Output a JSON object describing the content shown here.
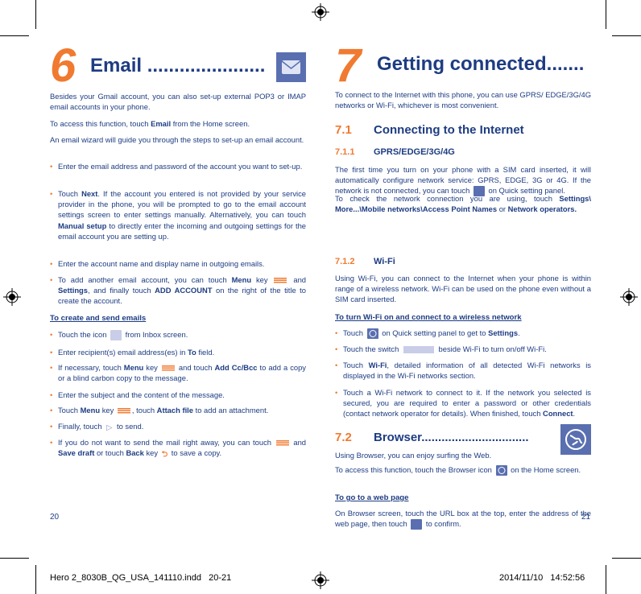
{
  "left": {
    "chapter_number": "6",
    "chapter_title": "Email ......................",
    "chapter_icon": "email-envelope-icon",
    "blocks": [
      {
        "type": "p",
        "seg": [
          {
            "t": "Besides your Gmail account, you can also set-up external POP3 or IMAP email accounts in your phone."
          }
        ]
      },
      {
        "type": "p",
        "seg": [
          {
            "t": "To access this function, touch "
          },
          {
            "t": "Email",
            "b": true
          },
          {
            "t": " from the Home screen."
          }
        ]
      },
      {
        "type": "p",
        "seg": [
          {
            "t": "An email wizard will guide you through the steps to set-up an email account."
          }
        ]
      },
      {
        "type": "bullet",
        "seg": [
          {
            "t": "Enter the email address and password of the account you want to set-up."
          }
        ]
      },
      {
        "type": "bullet",
        "seg": [
          {
            "t": "Touch "
          },
          {
            "t": "Next",
            "b": true
          },
          {
            "t": ". If the account you entered is not provided by your service provider in the phone, you will be prompted to go to the email account settings screen to enter settings manually. Alternatively, you can touch "
          },
          {
            "t": "Manual setup",
            "b": true
          },
          {
            "t": " to directly enter the incoming and outgoing settings for the email account you are setting up."
          }
        ]
      },
      {
        "type": "bullet",
        "seg": [
          {
            "t": "Enter the account name and display name in outgoing emails."
          }
        ]
      },
      {
        "type": "bullet",
        "seg": [
          {
            "t": "To add another email account, you can touch "
          },
          {
            "t": "Menu",
            "b": true
          },
          {
            "t": " key "
          },
          {
            "icon": "menu-key-icon"
          },
          {
            "t": " and "
          },
          {
            "t": "Settings",
            "b": true
          },
          {
            "t": ", and finally touch "
          },
          {
            "t": "ADD ACCOUNT",
            "b": true
          },
          {
            "t": " on the right of the title to create the account."
          }
        ]
      },
      {
        "type": "hlink",
        "seg": [
          {
            "t": "To create and send emails"
          }
        ]
      },
      {
        "type": "bullet",
        "seg": [
          {
            "t": "Touch the icon "
          },
          {
            "icon": "compose-email-icon"
          },
          {
            "t": " from Inbox screen."
          }
        ]
      },
      {
        "type": "bullet",
        "seg": [
          {
            "t": "Enter recipient(s) email address(es) in "
          },
          {
            "t": "To",
            "b": true
          },
          {
            "t": " field."
          }
        ]
      },
      {
        "type": "bullet",
        "seg": [
          {
            "t": "If necessary, touch "
          },
          {
            "t": "Menu",
            "b": true
          },
          {
            "t": " key "
          },
          {
            "icon": "menu-key-icon"
          },
          {
            "t": " and touch "
          },
          {
            "t": "Add Cc/Bcc",
            "b": true
          },
          {
            "t": " to add a copy or a blind carbon copy to the message."
          }
        ]
      },
      {
        "type": "bullet",
        "seg": [
          {
            "t": "Enter the subject and the content of the message."
          }
        ]
      },
      {
        "type": "bullet",
        "seg": [
          {
            "t": "Touch "
          },
          {
            "t": "Menu",
            "b": true
          },
          {
            "t": " key "
          },
          {
            "icon": "menu-key-icon"
          },
          {
            "t": ", touch "
          },
          {
            "t": "Attach file",
            "b": true
          },
          {
            "t": " to add an attachment."
          }
        ]
      },
      {
        "type": "bullet",
        "seg": [
          {
            "t": "Finally, touch "
          },
          {
            "icon": "send-icon"
          },
          {
            "t": " to send."
          }
        ]
      },
      {
        "type": "bullet",
        "seg": [
          {
            "t": "If you do not want to send the mail right away, you can touch "
          },
          {
            "icon": "menu-key-icon"
          },
          {
            "t": " and "
          },
          {
            "t": "Save draft",
            "b": true
          },
          {
            "t": " or touch "
          },
          {
            "t": "Back",
            "b": true
          },
          {
            "t": " key "
          },
          {
            "icon": "back-key-icon"
          },
          {
            "t": " to save a copy."
          }
        ]
      }
    ],
    "page_number": "20"
  },
  "right": {
    "chapter_number": "7",
    "chapter_title": "Getting connected.......",
    "blocks": [
      {
        "type": "p",
        "seg": [
          {
            "t": "To connect to the Internet with this phone, you can use GPRS/ EDGE/3G/4G networks or Wi-Fi, whichever is most convenient."
          }
        ]
      },
      {
        "type": "h2",
        "num": "7.1",
        "title": "Connecting to the Internet"
      },
      {
        "type": "h3",
        "num": "7.1.1",
        "title": "GPRS/EDGE/3G/4G"
      },
      {
        "type": "p",
        "seg": [
          {
            "t": "The first time you turn on your phone with a SIM card inserted, it will automatically configure network service: GPRS, EDGE, 3G or 4G. If the network is not connected, you can touch "
          },
          {
            "icon": "mobile-data-icon"
          },
          {
            "t": " on Quick setting panel."
          }
        ]
      },
      {
        "type": "p",
        "seg": [
          {
            "t": "To check the network connection you are using, touch "
          },
          {
            "t": "Settings\\ More...\\Mobile networks\\Access Point Names",
            "b": true
          },
          {
            "t": " or "
          },
          {
            "t": "Network operators.",
            "b": true
          }
        ]
      },
      {
        "type": "h3",
        "num": "7.1.2",
        "title": "Wi-Fi"
      },
      {
        "type": "p",
        "seg": [
          {
            "t": "Using Wi-Fi, you can connect to the Internet when your phone is within range of a wireless network. Wi-Fi can be used on the phone even without a SIM card inserted."
          }
        ]
      },
      {
        "type": "hlink",
        "seg": [
          {
            "t": "To turn Wi-Fi on and connect to a wireless network"
          }
        ]
      },
      {
        "type": "bullet",
        "seg": [
          {
            "t": "Touch "
          },
          {
            "icon": "settings-gear-icon"
          },
          {
            "t": " on Quick setting panel to get to "
          },
          {
            "t": "Settings",
            "b": true
          },
          {
            "t": "."
          }
        ]
      },
      {
        "type": "bullet",
        "seg": [
          {
            "t": "Touch the switch "
          },
          {
            "icon": "toggle-switch-icon"
          },
          {
            "t": " beside Wi-Fi to turn on/off Wi-Fi."
          }
        ]
      },
      {
        "type": "bullet",
        "seg": [
          {
            "t": "Touch "
          },
          {
            "t": "Wi-Fi",
            "b": true
          },
          {
            "t": ", detailed information of all detected Wi-Fi networks is displayed in the Wi-Fi networks section."
          }
        ]
      },
      {
        "type": "bullet",
        "seg": [
          {
            "t": "Touch a Wi-Fi network to connect to it. If the network you selected is secured, you are required to enter a password or other credentials (contact network operator for details). When finished, touch "
          },
          {
            "t": "Connect",
            "b": true
          },
          {
            "t": "."
          }
        ]
      },
      {
        "type": "h2",
        "num": "7.2",
        "title": "Browser................................",
        "icon": "browser-globe-icon"
      },
      {
        "type": "p",
        "seg": [
          {
            "t": "Using Browser, you can enjoy surfing the Web."
          }
        ]
      },
      {
        "type": "p",
        "seg": [
          {
            "t": "To access this function, touch the Browser icon "
          },
          {
            "icon": "browser-globe-icon"
          },
          {
            "t": " on the Home screen."
          }
        ]
      },
      {
        "type": "hlink",
        "seg": [
          {
            "t": "To go to a web page"
          }
        ]
      },
      {
        "type": "p",
        "seg": [
          {
            "t": "On Browser screen, touch the URL box at the top, enter the address of the web page, then touch "
          },
          {
            "icon": "go-button-icon"
          },
          {
            "t": " to confirm."
          }
        ]
      }
    ],
    "page_number": "21"
  },
  "slug": {
    "file": "Hero 2_8030B_QG_USA_141110.indd   20-21",
    "timestamp": "2014/11/10   14:52:56"
  },
  "colors": {
    "text": "#1d3c82",
    "accent": "#f07a30",
    "icon_bg": "#5a6fb0"
  }
}
